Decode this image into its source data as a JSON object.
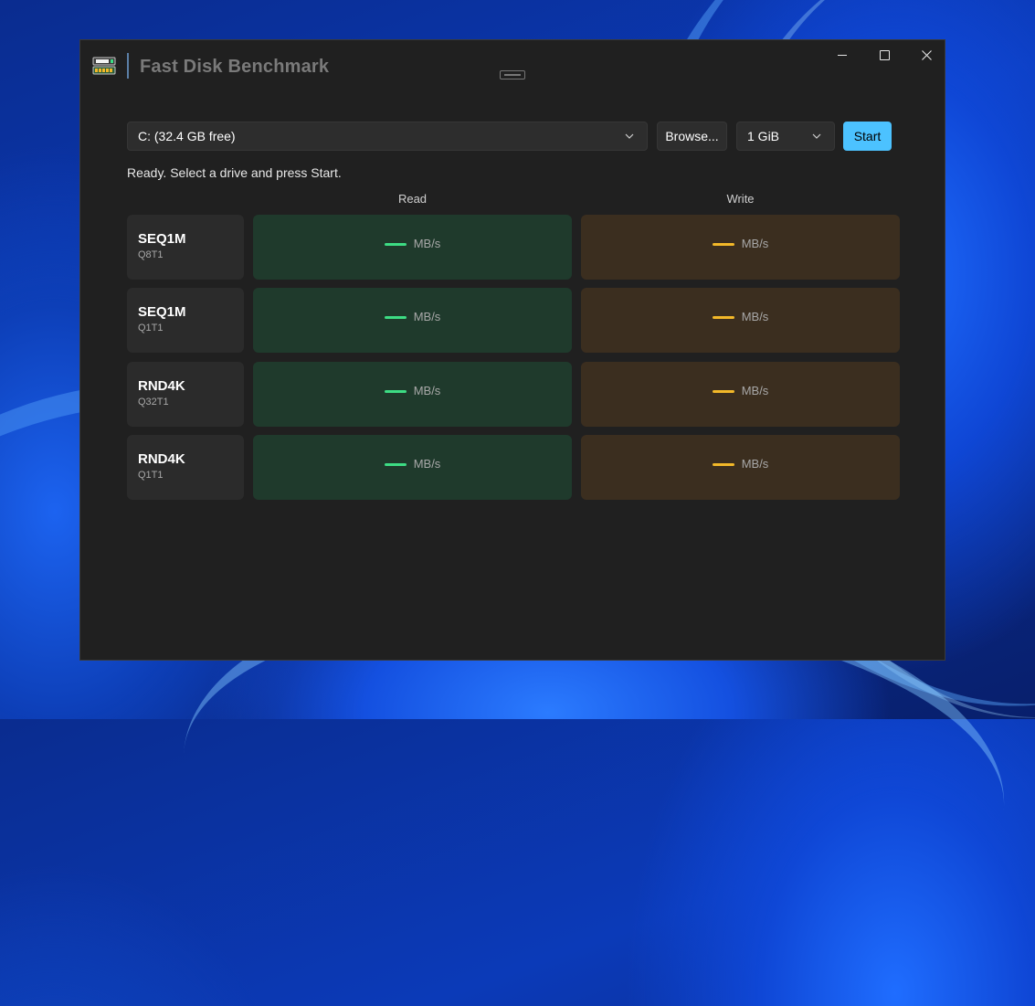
{
  "app": {
    "title": "Fast Disk Benchmark"
  },
  "window_controls": {
    "minimize_icon": "minimize-icon",
    "maximize_icon": "maximize-icon",
    "close_icon": "close-icon"
  },
  "toolbar": {
    "drive_value": "C: (32.4 GB free)",
    "browse_label": "Browse...",
    "size_value": "1 GiB",
    "start_label": "Start"
  },
  "status_text": "Ready. Select a drive and press Start.",
  "columns": {
    "read": "Read",
    "write": "Write"
  },
  "rows": [
    {
      "name": "SEQ1M",
      "sub": "Q8T1",
      "read_unit": "MB/s",
      "write_unit": "MB/s"
    },
    {
      "name": "SEQ1M",
      "sub": "Q1T1",
      "read_unit": "MB/s",
      "write_unit": "MB/s"
    },
    {
      "name": "RND4K",
      "sub": "Q32T1",
      "read_unit": "MB/s",
      "write_unit": "MB/s"
    },
    {
      "name": "RND4K",
      "sub": "Q1T1",
      "read_unit": "MB/s",
      "write_unit": "MB/s"
    }
  ],
  "colors": {
    "accent": "#4cc2ff",
    "read_dash": "#3ddc84",
    "write_dash": "#f2b829",
    "read_cell": "#1f3a2c",
    "write_cell": "#3b2e1f"
  }
}
